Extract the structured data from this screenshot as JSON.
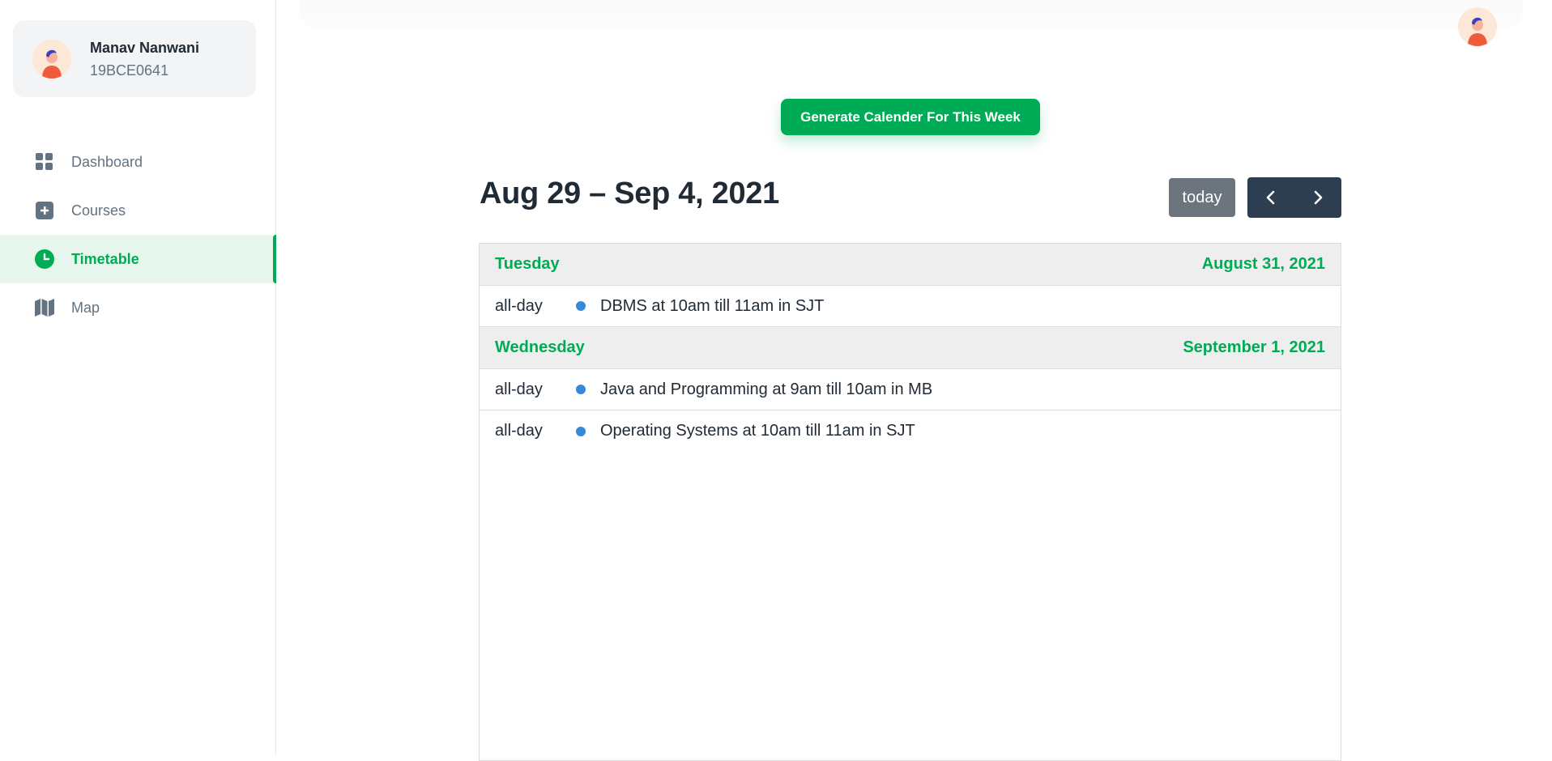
{
  "account": {
    "name": "Manav Nanwani",
    "id": "19BCE0641"
  },
  "nav": [
    {
      "label": "Dashboard",
      "icon": "dashboard-icon"
    },
    {
      "label": "Courses",
      "icon": "plus-square-icon"
    },
    {
      "label": "Timetable",
      "icon": "clock-icon",
      "active": true
    },
    {
      "label": "Map",
      "icon": "map-icon"
    }
  ],
  "generate_button": "Generate Calender For This Week",
  "calendar": {
    "title": "Aug 29 – Sep 4, 2021",
    "today_label": "today",
    "days": [
      {
        "weekday": "Tuesday",
        "date": "August 31, 2021",
        "events": [
          {
            "time": "all-day",
            "title": "DBMS at 10am till 11am in SJT"
          }
        ]
      },
      {
        "weekday": "Wednesday",
        "date": "September 1, 2021",
        "events": [
          {
            "time": "all-day",
            "title": "Java and Programming at 9am till 10am in MB"
          },
          {
            "time": "all-day",
            "title": "Operating Systems at 10am till 11am in SJT"
          }
        ]
      }
    ]
  },
  "colors": {
    "accent": "#00ab55",
    "event_dot": "#3788d8",
    "nav_buttons": "#2c3e50",
    "today_button": "#6c757d"
  }
}
